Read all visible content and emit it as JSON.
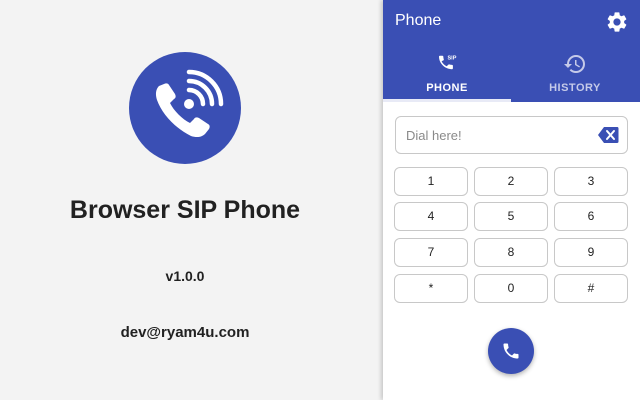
{
  "promo": {
    "title": "Browser SIP Phone",
    "version": "v1.0.0",
    "email": "dev@ryam4u.com",
    "logo_icon": "phone-ringing-icon"
  },
  "app": {
    "title": "Phone",
    "settings_icon": "gear-icon"
  },
  "tabs": [
    {
      "label": "PHONE",
      "icon": "sip-phone-icon",
      "active": true
    },
    {
      "label": "HISTORY",
      "icon": "history-icon",
      "active": false
    }
  ],
  "dialer": {
    "placeholder": "Dial here!",
    "backspace_icon": "backspace-icon",
    "keys": [
      "1",
      "2",
      "3",
      "4",
      "5",
      "6",
      "7",
      "8",
      "9",
      "*",
      "0",
      "#"
    ],
    "call_icon": "phone-icon"
  },
  "colors": {
    "primary": "#3a4fb4",
    "background": "#f3f3f3",
    "text": "#212121"
  }
}
